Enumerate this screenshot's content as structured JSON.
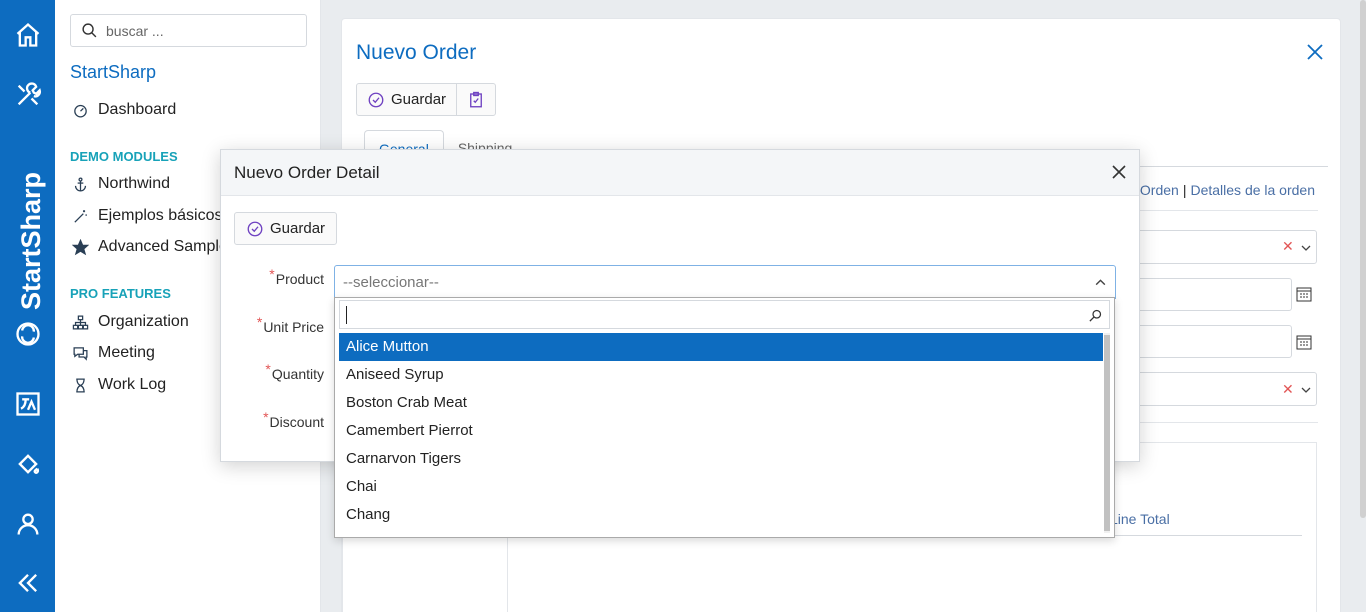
{
  "sidebar": {
    "search_placeholder": "buscar ...",
    "app_title": "StartSharp",
    "dashboard": "Dashboard",
    "demo_section": "DEMO MODULES",
    "demo_items": [
      "Northwind",
      "Ejemplos básicos",
      "Advanced Samples"
    ],
    "pro_section": "PRO FEATURES",
    "pro_items": [
      "Organization",
      "Meeting",
      "Work Log"
    ]
  },
  "rail": {
    "brand": "StartSharp",
    "icons": [
      "home-icon",
      "tools-icon",
      "translate-icon",
      "paint-bucket-icon",
      "user-icon",
      "collapse-icon"
    ],
    "accent": "#0d6cc0"
  },
  "card": {
    "title": "Nuevo Order",
    "save_label": "Guardar",
    "tabs": [
      "General",
      "Shipping"
    ],
    "links": [
      "Orden",
      "Detalles de la orden"
    ],
    "grid_col_line_total": "Line Total"
  },
  "modal": {
    "title": "Nuevo Order Detail",
    "save_label": "Guardar",
    "labels": [
      "Product",
      "Unit Price",
      "Quantity",
      "Discount"
    ],
    "product_placeholder": "--seleccionar--"
  },
  "dropdown": {
    "options": [
      "Alice Mutton",
      "Aniseed Syrup",
      "Boston Crab Meat",
      "Camembert Pierrot",
      "Carnarvon Tigers",
      "Chai",
      "Chang"
    ],
    "highlighted": "Alice Mutton"
  }
}
